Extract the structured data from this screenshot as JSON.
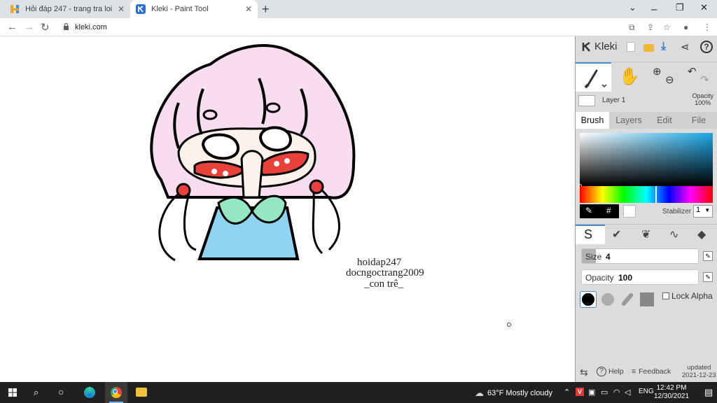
{
  "browser": {
    "tabs": [
      {
        "title": "Hỏi đáp 247 - trang tra loi"
      },
      {
        "title": "Kleki - Paint Tool"
      }
    ],
    "new_tab": "+",
    "window_controls": {
      "minimize": "⌄",
      "restore": "❐",
      "close": "✕"
    },
    "url": "kleki.com",
    "nav": {
      "back": "←",
      "forward": "→",
      "reload": "↻"
    }
  },
  "canvas": {
    "watermark": [
      "hoidap247",
      "docngoctrang2009",
      "_con trê_"
    ]
  },
  "panel": {
    "brand": "Kleki",
    "layer": {
      "name": "Layer 1",
      "opacity_label": "Opacity",
      "opacity_value": "100%"
    },
    "tabs": [
      "Brush",
      "Layers",
      "Edit",
      "File"
    ],
    "color_hex_btn": "#",
    "stabilizer_label": "Stabilizer",
    "stabilizer_value": "1",
    "size_label": "Size",
    "size_value": "4",
    "size_level": 0.12,
    "opacity_label": "Opacity",
    "opacity_value": "100",
    "opacity_level": 1.0,
    "lock_alpha": "Lock Alpha",
    "footer": {
      "help": "Help",
      "feedback": "Feedback",
      "updated": "updated",
      "updated_date": "2021-12-23"
    },
    "accent": "#4b8bd6"
  },
  "taskbar": {
    "weather": "63°F  Mostly cloudy",
    "lang": "ENG",
    "time": "12:42 PM",
    "date": "12/30/2021"
  }
}
